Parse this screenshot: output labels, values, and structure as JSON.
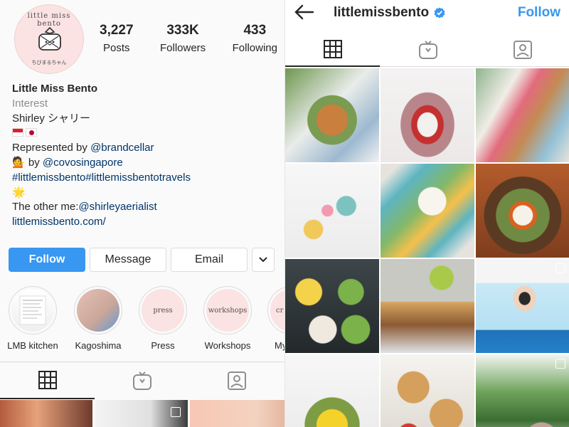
{
  "profile": {
    "avatar_text_top": "little miss bento",
    "avatar_text_bottom": "ちびまるちゃん",
    "stats": [
      {
        "value": "3,227",
        "label": "Posts"
      },
      {
        "value": "333K",
        "label": "Followers"
      },
      {
        "value": "433",
        "label": "Following"
      }
    ],
    "display_name": "Little Miss Bento",
    "category": "Interest",
    "bio_line1": "Shirley シャリー",
    "represented_prefix": "Represented by ",
    "represented_link": "@brandcellar",
    "by_prefix": " by ",
    "by_link": "@covosingapore",
    "hashtags": "#littlemissbento#littlemissbentotravels",
    "other_prefix": "The other me:",
    "other_link": "@shirleyaerialist",
    "website": "littlemissbento.com/"
  },
  "actions": {
    "follow": "Follow",
    "message": "Message",
    "email": "Email"
  },
  "highlights": [
    {
      "label": "LMB kitchen",
      "inner": ""
    },
    {
      "label": "Kagoshima",
      "inner": ""
    },
    {
      "label": "Press",
      "inner": "press"
    },
    {
      "label": "Workshops",
      "inner": "workshops"
    },
    {
      "label": "My",
      "inner": "cr"
    }
  ],
  "header": {
    "username": "littlemissbento",
    "follow": "Follow"
  },
  "colors": {
    "accent": "#3897f0",
    "link": "#003569",
    "verified": "#3897f0"
  },
  "icons": {
    "back": "arrow-left-icon",
    "grid": "grid-icon",
    "igtv": "tv-icon",
    "tagged": "tagged-icon",
    "verified": "verified-badge-icon",
    "chevron": "chevron-down-icon",
    "multi": "multiple-posts-icon"
  }
}
